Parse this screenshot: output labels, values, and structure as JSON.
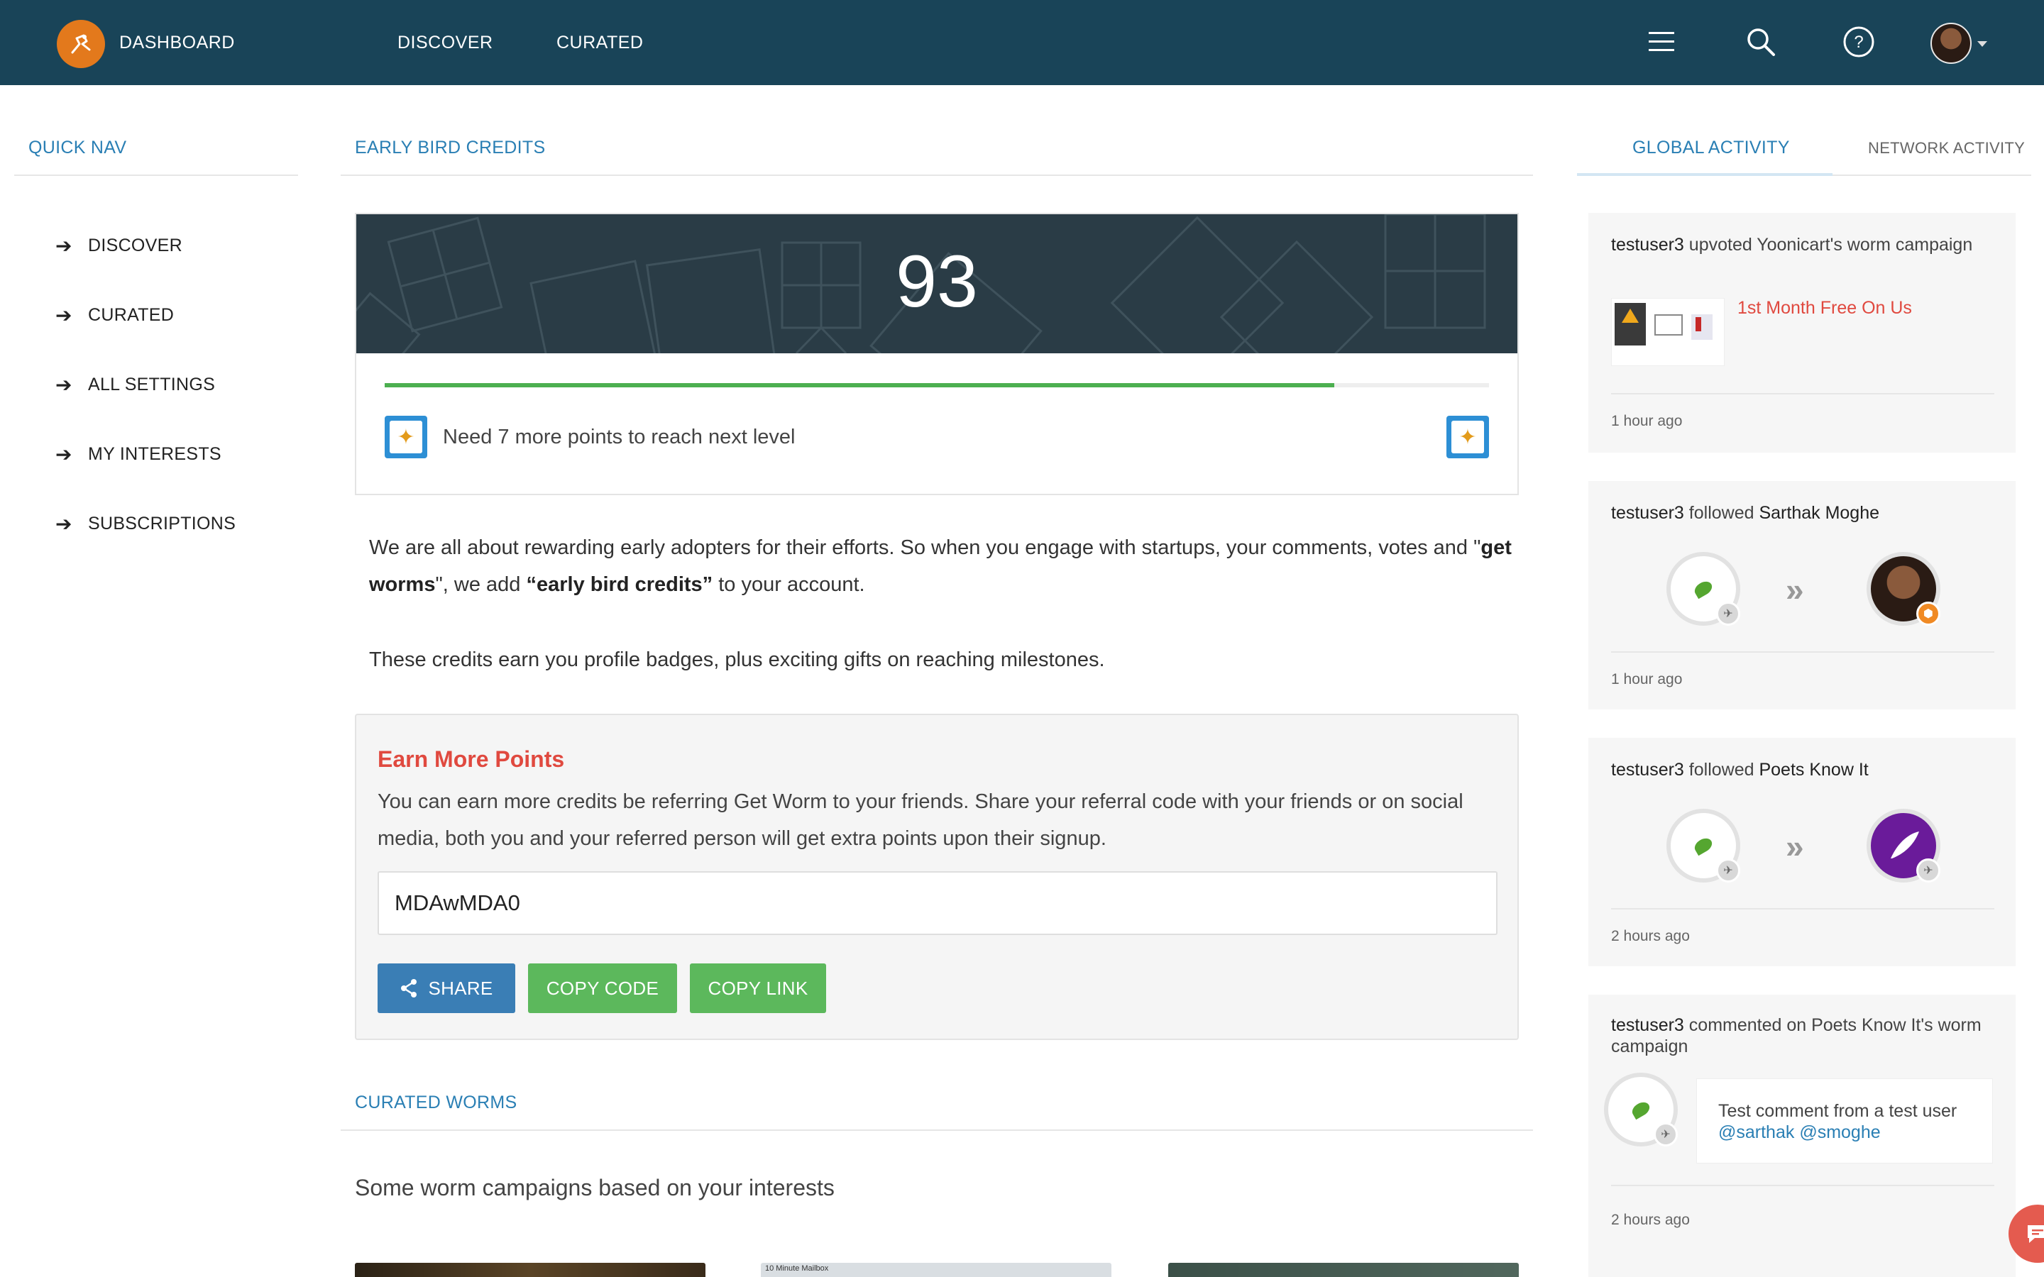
{
  "topnav": {
    "brand": "DASHBOARD",
    "links": [
      "DISCOVER",
      "CURATED"
    ]
  },
  "quick_nav": {
    "title": "QUICK NAV",
    "items": [
      "DISCOVER",
      "CURATED",
      "ALL SETTINGS",
      "MY INTERESTS",
      "SUBSCRIPTIONS"
    ]
  },
  "credits": {
    "title": "EARLY BIRD CREDITS",
    "score": "93",
    "progress_percent": 86,
    "level_text": "Need 7 more points to reach next level",
    "intro_part1": "We are all about rewarding early adopters for their efforts. So when you engage with startups, your comments, votes and \"",
    "intro_bold1": "get worms",
    "intro_part2": "\", we add ",
    "intro_bold2": "“early bird credits”",
    "intro_part3": " to your account.",
    "intro2": "These credits earn you profile badges, plus exciting gifts on reaching milestones."
  },
  "earn": {
    "title": "Earn More Points",
    "description": "You can earn more credits be referring Get Worm to your friends. Share your referral code with your friends or on social media, both you and your referred person will get extra points upon their signup.",
    "code": "MDAwMDA0",
    "share_label": "SHARE",
    "copy_code_label": "COPY CODE",
    "copy_link_label": "COPY LINK"
  },
  "curated_worms": {
    "title": "CURATED WORMS",
    "subtitle": "Some worm campaigns based on your interests",
    "thumb_caption": "10 Minute Mailbox"
  },
  "activity": {
    "tab_global": "GLOBAL ACTIVITY",
    "tab_network": "NETWORK ACTIVITY",
    "items": [
      {
        "user": "testuser3",
        "action": " upvoted Yoonicart's worm campaign",
        "link": "1st Month Free On Us",
        "time": "1 hour ago"
      },
      {
        "user": "testuser3",
        "action": " followed ",
        "target": "Sarthak Moghe",
        "time": "1 hour ago"
      },
      {
        "user": "testuser3",
        "action": " followed ",
        "target": "Poets Know It",
        "time": "2 hours ago"
      },
      {
        "user": "testuser3",
        "action": " commented on Poets Know It's worm campaign",
        "comment": "Test comment from a test user ",
        "mention1": "@sarthak",
        "mention2": "@smoghe",
        "time": "2 hours ago"
      }
    ]
  },
  "colors": {
    "topbar": "#194458",
    "accent": "#2a7fb4",
    "progress": "#4caf50",
    "earn_title": "#e0493f",
    "share_button": "#3a7eb5",
    "copy_button": "#5cb85c"
  }
}
